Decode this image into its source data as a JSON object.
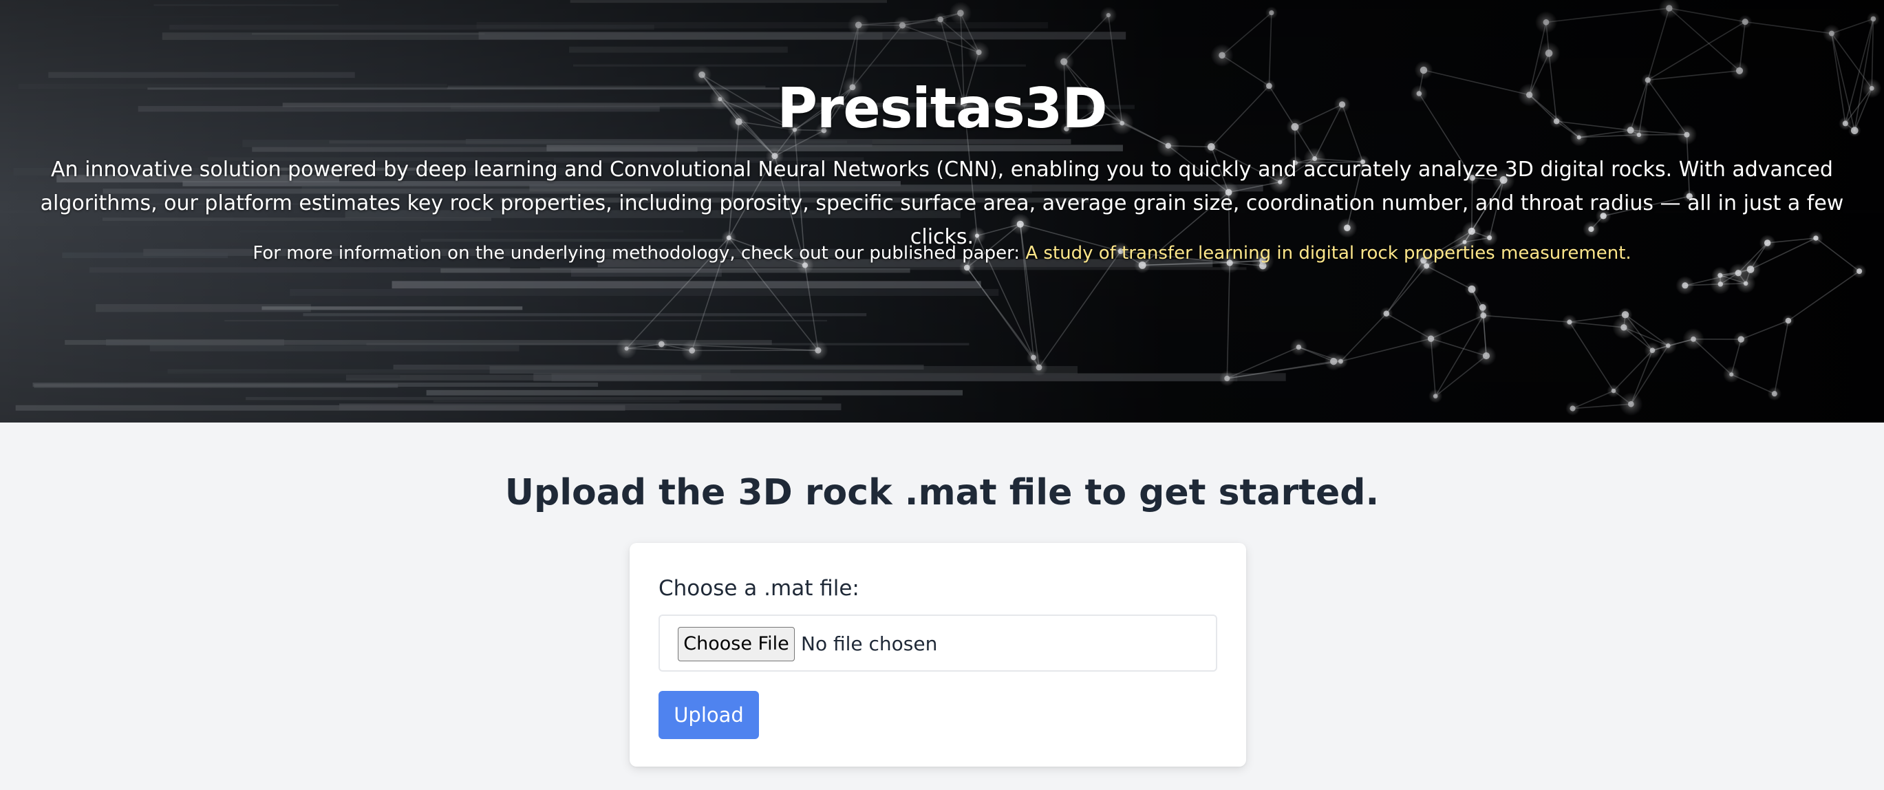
{
  "hero": {
    "title": "Presitas3D",
    "description": "An innovative solution powered by deep learning and Convolutional Neural Networks (CNN), enabling you to quickly and accurately analyze 3D digital rocks. With advanced algorithms, our platform estimates key rock properties, including porosity, specific surface area, average grain size, coordination number, and throat radius — all in just a few clicks.",
    "paper_intro": "For more information on the underlying methodology, check out our published paper: ",
    "paper_link_text": "A study of transfer learning in digital rock properties measurement."
  },
  "main": {
    "heading": "Upload the 3D rock .mat file to get started."
  },
  "upload_form": {
    "label": "Choose a .mat file:",
    "choose_button": "Choose File",
    "file_status": "No file chosen",
    "upload_button": "Upload"
  },
  "colors": {
    "page_background": "#f3f4f6",
    "heading_text": "#1f2937",
    "link": "#fde68a",
    "primary_button": "#4f83ef"
  }
}
